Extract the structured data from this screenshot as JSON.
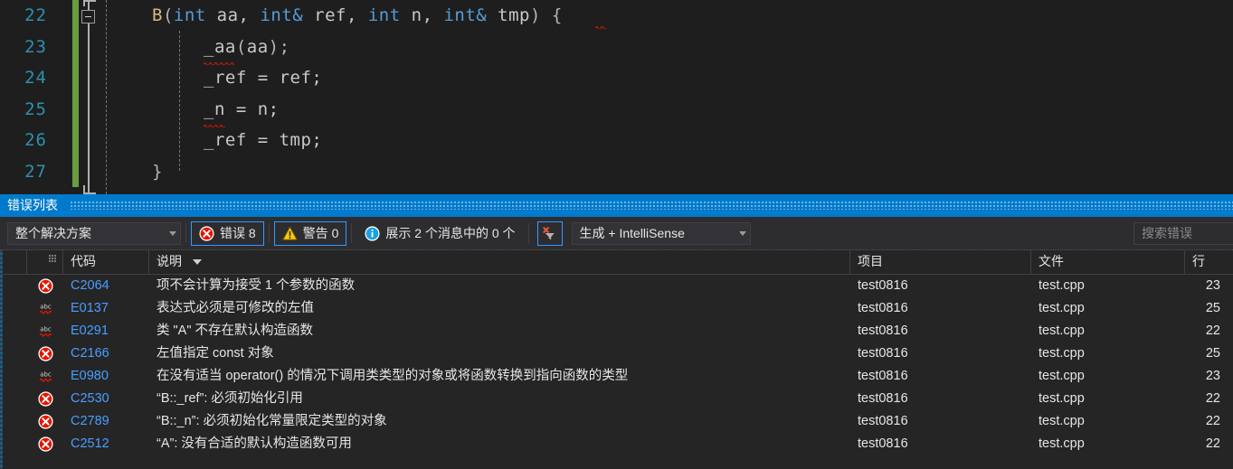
{
  "editor": {
    "lines": [
      {
        "number": "22",
        "tokens": [
          {
            "t": "B",
            "c": "cls"
          },
          {
            "t": "(",
            "c": "punct"
          },
          {
            "t": "int",
            "c": "kw"
          },
          {
            "t": " aa, ",
            "c": "plain"
          },
          {
            "t": "int",
            "c": "kw"
          },
          {
            "t": "&",
            "c": "kw"
          },
          {
            "t": " ref, ",
            "c": "plain"
          },
          {
            "t": "int",
            "c": "kw"
          },
          {
            "t": " n, ",
            "c": "plain"
          },
          {
            "t": "int",
            "c": "kw"
          },
          {
            "t": "&",
            "c": "kw"
          },
          {
            "t": " tmp",
            "c": "plain"
          },
          {
            "t": ") {",
            "c": "punct"
          }
        ],
        "indent": 0
      },
      {
        "number": "23",
        "tokens": [
          {
            "t": "_aa",
            "c": "plain"
          },
          {
            "t": "(",
            "c": "punct"
          },
          {
            "t": "aa",
            "c": "plain"
          },
          {
            "t": ");",
            "c": "punct"
          }
        ],
        "indent": 57
      },
      {
        "number": "24",
        "tokens": [
          {
            "t": "_ref = ref;",
            "c": "plain"
          }
        ],
        "indent": 57
      },
      {
        "number": "25",
        "tokens": [
          {
            "t": "_n = n;",
            "c": "plain"
          }
        ],
        "indent": 57
      },
      {
        "number": "26",
        "tokens": [
          {
            "t": "_ref = tmp;",
            "c": "plain"
          }
        ],
        "indent": 57
      },
      {
        "number": "27",
        "tokens": [
          {
            "t": "}",
            "c": "punct"
          }
        ],
        "indent": 0
      }
    ]
  },
  "panel": {
    "title": "错误列表",
    "toolbar": {
      "scope_value": "整个解决方案",
      "errors_label": "错误 8",
      "warnings_label": "警告 0",
      "messages_label": "展示 2 个消息中的 0 个",
      "build_value": "生成 + IntelliSense",
      "search_placeholder": "搜索错误"
    },
    "columns": {
      "code": "代码",
      "description": "说明",
      "project": "项目",
      "file": "文件",
      "line": "行"
    },
    "rows": [
      {
        "severity": "error",
        "code": "C2064",
        "description": "项不会计算为接受 1 个参数的函数",
        "project": "test0816",
        "file": "test.cpp",
        "line": "23"
      },
      {
        "severity": "intellisense",
        "code": "E0137",
        "description": "表达式必须是可修改的左值",
        "project": "test0816",
        "file": "test.cpp",
        "line": "25"
      },
      {
        "severity": "intellisense",
        "code": "E0291",
        "description": "类 \"A\" 不存在默认构造函数",
        "project": "test0816",
        "file": "test.cpp",
        "line": "22"
      },
      {
        "severity": "error",
        "code": "C2166",
        "description": "左值指定 const 对象",
        "project": "test0816",
        "file": "test.cpp",
        "line": "25"
      },
      {
        "severity": "intellisense",
        "code": "E0980",
        "description": "在没有适当 operator() 的情况下调用类类型的对象或将函数转换到指向函数的类型",
        "project": "test0816",
        "file": "test.cpp",
        "line": "23"
      },
      {
        "severity": "error",
        "code": "C2530",
        "description": "“B::_ref”: 必须初始化引用",
        "project": "test0816",
        "file": "test.cpp",
        "line": "22"
      },
      {
        "severity": "error",
        "code": "C2789",
        "description": "“B::_n”: 必须初始化常量限定类型的对象",
        "project": "test0816",
        "file": "test.cpp",
        "line": "22"
      },
      {
        "severity": "error",
        "code": "C2512",
        "description": "“A”: 没有合适的默认构造函数可用",
        "project": "test0816",
        "file": "test.cpp",
        "line": "22"
      }
    ]
  },
  "colors": {
    "accent": "#007acc",
    "error_red": "#e51400",
    "warning_yellow": "#ffcc00",
    "info_blue": "#1ba1e2",
    "code_link": "#4a9eff",
    "linenumber": "#2b91af",
    "changebar_green": "#6a9c40"
  }
}
